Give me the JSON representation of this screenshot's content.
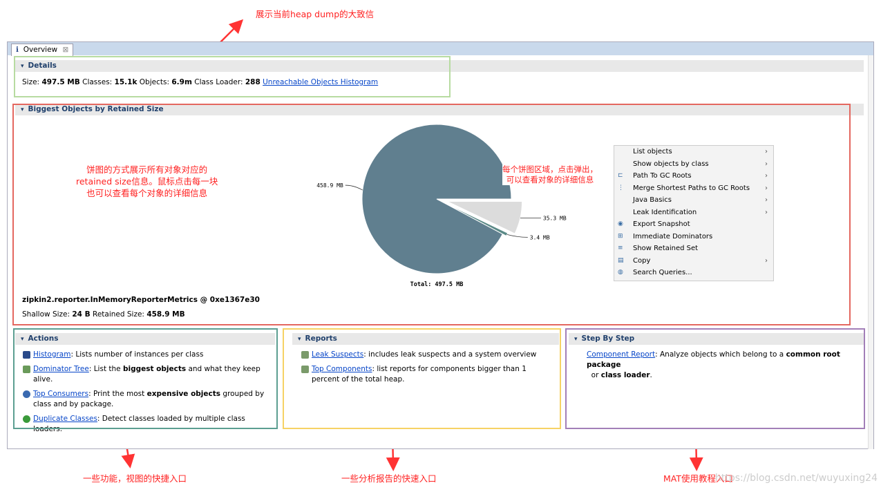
{
  "annotations": {
    "top": "展示当前heap dump的大致信",
    "pie_left": "饼图的方式展示所有对象对应的\nretained size信息。鼠标点击每一块\n也可以查看每个对象的详细信息",
    "pie_click": "每个饼图区域，点击弹出，\n可以查看对象的详细信息",
    "actions": "一些功能，视图的快捷入口",
    "reports": "一些分析报告的快速入口",
    "stepbystep": "MAT使用教程入口",
    "watermark": "https://blog.csdn.net/wuyuxing24"
  },
  "tab": {
    "label": "Overview",
    "icon": "info-icon"
  },
  "details": {
    "title": "Details",
    "size_label": "Size:",
    "size": "497.5 MB",
    "classes_label": "Classes:",
    "classes": "15.1k",
    "objects_label": "Objects:",
    "objects": "6.9m",
    "loader_label": "Class Loader:",
    "loader": "288",
    "link": "Unreachable Objects Histogram"
  },
  "biggest": {
    "title": "Biggest Objects by Retained Size",
    "object_name": "zipkin2.reporter.InMemoryReporterMetrics @ 0xe1367e30",
    "shallow_label": "Shallow Size:",
    "shallow": "24 B",
    "retained_label": "Retained Size:",
    "retained": "458.9 MB"
  },
  "chart_data": {
    "type": "pie",
    "unit": "MB",
    "total_label": "Total: 497.5 MB",
    "slices": [
      {
        "label": "458.9 MB",
        "value": 458.9,
        "color": "#607f8f"
      },
      {
        "label": "35.3 MB",
        "value": 35.3,
        "color": "#dcdcdc"
      },
      {
        "label": "3.4 MB",
        "value": 3.4,
        "color": "#5b8a87"
      }
    ]
  },
  "menu": [
    {
      "label": "List objects",
      "sub": true,
      "icon": ""
    },
    {
      "label": "Show objects by class",
      "sub": true,
      "icon": ""
    },
    {
      "label": "Path To GC Roots",
      "sub": true,
      "icon": "path-icon"
    },
    {
      "label": "Merge Shortest Paths to GC Roots",
      "sub": true,
      "icon": "merge-paths-icon"
    },
    {
      "label": "Java Basics",
      "sub": true,
      "icon": ""
    },
    {
      "label": "Leak Identification",
      "sub": true,
      "icon": ""
    },
    {
      "label": "Export Snapshot",
      "sub": false,
      "icon": "export-icon"
    },
    {
      "label": "Immediate Dominators",
      "sub": false,
      "icon": "dominators-icon"
    },
    {
      "label": "Show Retained Set",
      "sub": false,
      "icon": "retained-set-icon"
    },
    {
      "label": "Copy",
      "sub": true,
      "icon": "copy-icon"
    },
    {
      "label": "Search Queries...",
      "sub": false,
      "icon": "search-queries-icon"
    }
  ],
  "actions": {
    "title": "Actions",
    "items": [
      {
        "link": "Histogram",
        "pre": ": Lists number of instances per class",
        "bold": "",
        "post": ""
      },
      {
        "link": "Dominator Tree",
        "pre": ": List the ",
        "bold": "biggest objects",
        "post": " and what they keep alive."
      },
      {
        "link": "Top Consumers",
        "pre": ": Print the most ",
        "bold": "expensive objects",
        "post": " grouped by class and by package."
      },
      {
        "link": "Duplicate Classes",
        "pre": ": Detect classes loaded by multiple class loaders.",
        "bold": "",
        "post": ""
      }
    ]
  },
  "reports": {
    "title": "Reports",
    "items": [
      {
        "link": "Leak Suspects",
        "text": ": includes leak suspects and a system overview"
      },
      {
        "link": "Top Components",
        "text": ": list reports for components bigger than 1 percent of the total heap."
      }
    ]
  },
  "step": {
    "title": "Step By Step",
    "link": "Component Report",
    "t1": ": Analyze objects which belong to a ",
    "b1": "common root package",
    "t2": " or ",
    "b2": "class loader",
    "t3": "."
  }
}
